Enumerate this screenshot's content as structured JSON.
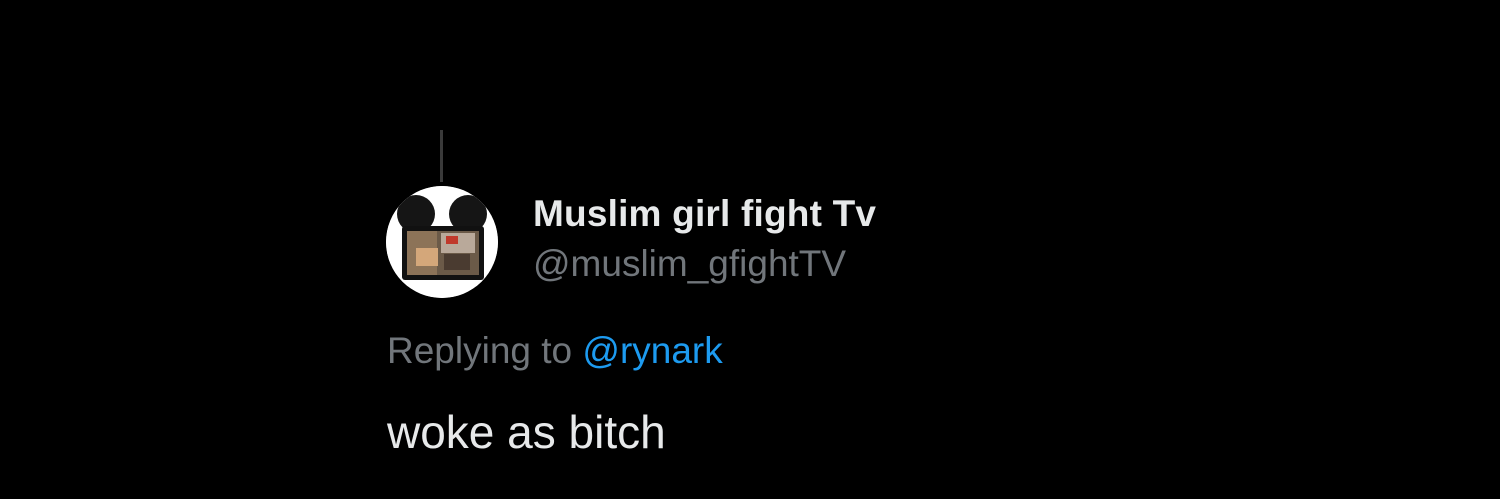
{
  "tweet": {
    "author": {
      "display_name": "Muslim girl fight Tv",
      "handle": "@muslim_gfightTV",
      "avatar_icon": "mouse-ears-tv-avatar"
    },
    "reply": {
      "prefix": "Replying to",
      "mention": "@rynark"
    },
    "text": "woke as bitch"
  },
  "colors": {
    "background": "#000000",
    "primary_text": "#e7e9ea",
    "secondary_text": "#71767b",
    "link": "#1d9bf0"
  }
}
